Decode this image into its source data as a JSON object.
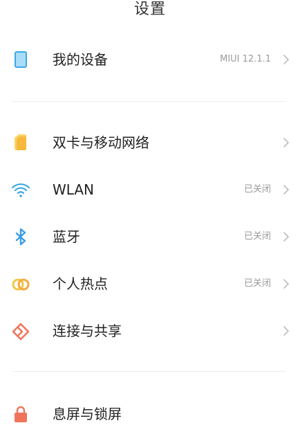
{
  "header": {
    "title": "设置"
  },
  "group1": {
    "my_device": {
      "label": "我的设备",
      "value": "MIUI 12.1.1",
      "icon": "device-icon"
    }
  },
  "group2": {
    "items": [
      {
        "label": "双卡与移动网络",
        "value": "",
        "icon": "sim-card-icon"
      },
      {
        "label": "WLAN",
        "value": "已关闭",
        "icon": "wifi-icon"
      },
      {
        "label": "蓝牙",
        "value": "已关闭",
        "icon": "bluetooth-icon"
      },
      {
        "label": "个人热点",
        "value": "已关闭",
        "icon": "hotspot-icon"
      },
      {
        "label": "连接与共享",
        "value": "",
        "icon": "connection-share-icon"
      }
    ]
  },
  "group3": {
    "lock_screen": {
      "label": "息屏与锁屏",
      "icon": "lock-icon"
    }
  },
  "colors": {
    "device": "#5bb8ec",
    "sim": "#f6b93b",
    "wifi": "#3aa8e6",
    "bluetooth": "#3a9be6",
    "hotspot": "#f4c542",
    "share": "#f0745b",
    "lock": "#f0745b"
  }
}
